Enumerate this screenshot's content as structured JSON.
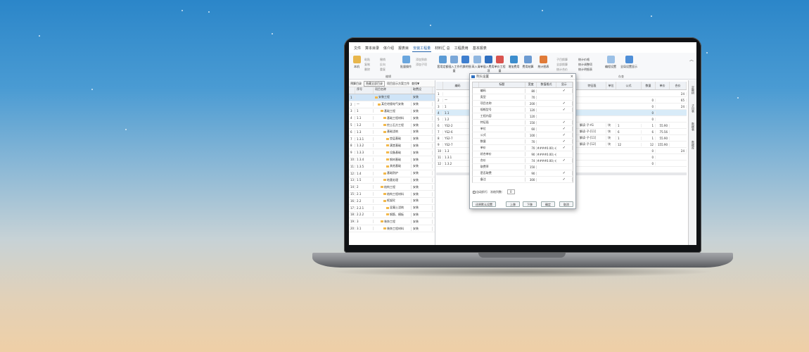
{
  "app": {
    "menu": [
      "文件",
      "算本目录",
      "体介绍",
      "报表目",
      "安装工程量",
      "材料汇 总",
      "工程费用",
      "基本报表"
    ],
    "active_menu_index": 4,
    "ribbon": {
      "left_big": "本机",
      "small_col1": [
        "粘贴",
        "复制",
        "删除"
      ],
      "small_col2": [
        "撤销",
        "反向",
        "重复"
      ],
      "big2": "批量操作",
      "small_col3": [
        "添加到前",
        "添加子项"
      ],
      "group_edit": "编辑",
      "tools": [
        "套用定额",
        "插入工作量",
        "代换明细",
        "高入清单",
        "插入费用项",
        "单价工程量",
        "增加费用",
        "费用结算",
        "统计图表"
      ],
      "small_col4": [
        "子目换算",
        "全部换算",
        "统计合价"
      ],
      "small_col5": [
        "统计价格",
        "统计调整项",
        "统计明细表"
      ],
      "right_tools": [
        "编程设置",
        "全局设置显示"
      ],
      "group_right": "存查"
    },
    "left_pane": {
      "toolbar_label": "预算目录",
      "toolbar_select": "隐藏全部目录",
      "toolbar_label2": "项目显示方案工作",
      "toolbar_label3": "查找▼",
      "headers": [
        "",
        "序号",
        "项目名称",
        "取费设"
      ],
      "rows": [
        {
          "n": "1",
          "code": "",
          "name": "安装工程",
          "fee": "安装",
          "indent": 0,
          "sel": true
        },
        {
          "n": "2",
          "code": "一",
          "name": "某住宅楼电气安装",
          "fee": "安装",
          "indent": 1
        },
        {
          "n": "3",
          "code": "1",
          "name": "基础工程",
          "fee": "安装",
          "indent": 2
        },
        {
          "n": "4",
          "code": "1.1",
          "name": "基础工程材料",
          "fee": "安装",
          "indent": 3
        },
        {
          "n": "5",
          "code": "1.2",
          "name": "挖土石方工程",
          "fee": "安装",
          "indent": 3
        },
        {
          "n": "6",
          "code": "1.3",
          "name": "基础浇筑",
          "fee": "安装",
          "indent": 3
        },
        {
          "n": "7",
          "code": "1.3.1",
          "name": "垫层基础",
          "fee": "安装",
          "indent": 4
        },
        {
          "n": "8",
          "code": "1.3.2",
          "name": "满堂基础",
          "fee": "安装",
          "indent": 4
        },
        {
          "n": "9",
          "code": "1.3.3",
          "name": "设备基础",
          "fee": "安装",
          "indent": 4
        },
        {
          "n": "10",
          "code": "1.3.4",
          "name": "钢材基础",
          "fee": "安装",
          "indent": 4
        },
        {
          "n": "11",
          "code": "1.3.5",
          "name": "其他基础",
          "fee": "安装",
          "indent": 4
        },
        {
          "n": "12",
          "code": "1.4",
          "name": "基础防护",
          "fee": "安装",
          "indent": 3
        },
        {
          "n": "13",
          "code": "1.5",
          "name": "地基处理",
          "fee": "安装",
          "indent": 3
        },
        {
          "n": "14",
          "code": "2",
          "name": "结构工程",
          "fee": "安装",
          "indent": 2
        },
        {
          "n": "15",
          "code": "2.1",
          "name": "结构工程材料",
          "fee": "安装",
          "indent": 3
        },
        {
          "n": "16",
          "code": "2.2",
          "name": "框架砼",
          "fee": "安装",
          "indent": 3
        },
        {
          "n": "17",
          "code": "2.2.1",
          "name": "混凝土浇筑",
          "fee": "安装",
          "indent": 4
        },
        {
          "n": "18",
          "code": "2.2.2",
          "name": "钢筋、模板",
          "fee": "安装",
          "indent": 4
        },
        {
          "n": "19",
          "code": "3",
          "name": "装饰工程",
          "fee": "安装",
          "indent": 2
        },
        {
          "n": "20",
          "code": "3.1",
          "name": "装饰工程材料",
          "fee": "安装",
          "indent": 3
        }
      ]
    },
    "right_pane": {
      "headers": [
        "",
        "编码",
        "",
        "",
        "",
        "",
        "",
        "",
        "",
        "",
        "特征段",
        "单位",
        "公式",
        "数量",
        "单价",
        "合价"
      ],
      "rows": [
        {
          "n": "1",
          "code": "",
          "trait": "",
          "unit": "",
          "formula": "",
          "qty": "",
          "price": "",
          "total": "24"
        },
        {
          "n": "2",
          "code": "一",
          "trait": "",
          "unit": "",
          "formula": "",
          "qty": "0",
          "price": "",
          "total": "65"
        },
        {
          "n": "3",
          "code": "1",
          "trait": "",
          "unit": "",
          "formula": "",
          "qty": "0",
          "price": "",
          "total": "24"
        },
        {
          "n": "4",
          "code": "1.1",
          "trait": "",
          "unit": "",
          "formula": "",
          "qty": "0",
          "price": "",
          "total": "",
          "sel": true
        },
        {
          "n": "5",
          "code": "1.2",
          "trait": "",
          "unit": "",
          "formula": "",
          "qty": "0",
          "price": "",
          "total": ""
        },
        {
          "n": "6",
          "code": "YS2-2",
          "trait": "解读-子-A1",
          "unit": "块",
          "formula": "1",
          "qty": "1",
          "price": "55.90",
          "total": ""
        },
        {
          "n": "7",
          "code": "YS2-6",
          "trait": "解读-子-[11]",
          "unit": "块",
          "formula": "6",
          "qty": "6",
          "price": "75.56",
          "total": ""
        },
        {
          "n": "8",
          "code": "YS2-7",
          "trait": "解读-子-[11]",
          "unit": "块",
          "formula": "1",
          "qty": "1",
          "price": "55.90",
          "total": ""
        },
        {
          "n": "9",
          "code": "YS2-7",
          "trait": "解读-子-[12]",
          "unit": "块",
          "formula": "12",
          "qty": "12",
          "price": "155.90",
          "total": ""
        },
        {
          "n": "10",
          "code": "1.3",
          "trait": "",
          "unit": "",
          "formula": "",
          "qty": "0",
          "price": "",
          "total": "24"
        },
        {
          "n": "11",
          "code": "1.3.1",
          "trait": "",
          "unit": "",
          "formula": "",
          "qty": "0",
          "price": "",
          "total": ""
        },
        {
          "n": "12",
          "code": "1.3.2",
          "trait": "",
          "unit": "",
          "formula": "",
          "qty": "0",
          "price": "",
          "total": ""
        }
      ],
      "side_tabs": [
        "定额树",
        "子目表",
        "数据表",
        "数据库"
      ]
    },
    "dialog": {
      "title": "列头设置",
      "close": "×",
      "headers": [
        "",
        "标题",
        "宽度",
        "数值格式",
        "显示"
      ],
      "rows": [
        {
          "title": "编码",
          "width": "80",
          "fmt": "",
          "show": true
        },
        {
          "title": "类型",
          "width": "70",
          "fmt": "",
          "show": false
        },
        {
          "title": "项目名称",
          "width": "200",
          "fmt": "",
          "show": true
        },
        {
          "title": "规格型号",
          "width": "120",
          "fmt": "",
          "show": true
        },
        {
          "title": "工程内容",
          "width": "120",
          "fmt": "",
          "show": false
        },
        {
          "title": "特征段",
          "width": "150",
          "fmt": "",
          "show": true
        },
        {
          "title": "单位",
          "width": "60",
          "fmt": "",
          "show": true
        },
        {
          "title": "公式",
          "width": "100",
          "fmt": "",
          "show": true
        },
        {
          "title": "数量",
          "width": "70",
          "fmt": "",
          "show": true
        },
        {
          "title": "单价",
          "width": "70",
          "fmt": "####0.00;-#",
          "show": true
        },
        {
          "title": "综合单价",
          "width": "90",
          "fmt": "####0.00;-#",
          "show": false
        },
        {
          "title": "合价",
          "width": "74",
          "fmt": "####0.00;-#",
          "show": true
        },
        {
          "title": "取费率",
          "width": "150",
          "fmt": "",
          "show": false
        },
        {
          "title": "是否取费",
          "width": "90",
          "fmt": "",
          "show": true
        },
        {
          "title": "备注",
          "width": "300",
          "fmt": "",
          "show": true
        }
      ],
      "auto_wrap": "自动折行",
      "freeze_label": "冻结列数：",
      "freeze_value": "0",
      "restore_btn": "还原默认设置",
      "up_btn": "上移",
      "down_btn": "下移",
      "ok_btn": "确定",
      "cancel_btn": "取消"
    }
  },
  "colors": {
    "accent": "#1f5fa8",
    "selected_row": "#cfe4f7"
  }
}
